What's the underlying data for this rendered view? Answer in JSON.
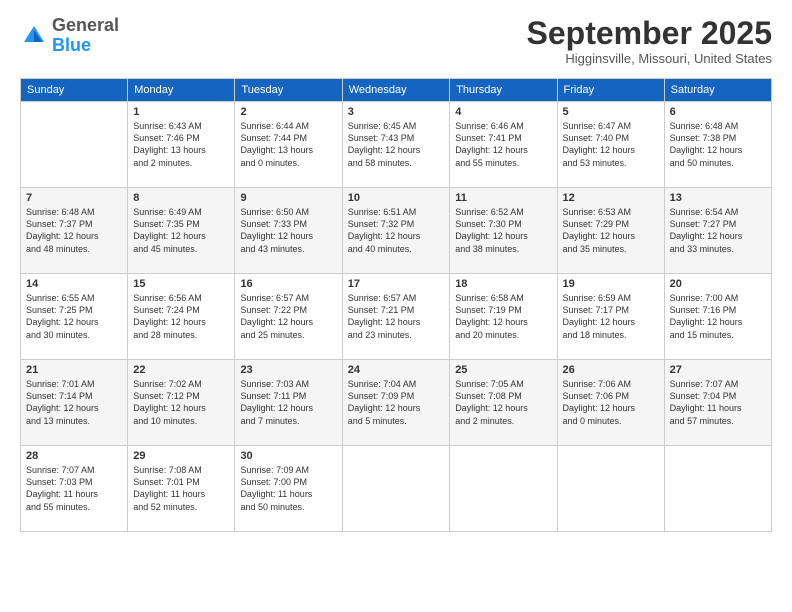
{
  "header": {
    "logo_general": "General",
    "logo_blue": "Blue",
    "month_title": "September 2025",
    "location": "Higginsville, Missouri, United States"
  },
  "days_of_week": [
    "Sunday",
    "Monday",
    "Tuesday",
    "Wednesday",
    "Thursday",
    "Friday",
    "Saturday"
  ],
  "weeks": [
    [
      {
        "day": "",
        "info": ""
      },
      {
        "day": "1",
        "info": "Sunrise: 6:43 AM\nSunset: 7:46 PM\nDaylight: 13 hours\nand 2 minutes."
      },
      {
        "day": "2",
        "info": "Sunrise: 6:44 AM\nSunset: 7:44 PM\nDaylight: 13 hours\nand 0 minutes."
      },
      {
        "day": "3",
        "info": "Sunrise: 6:45 AM\nSunset: 7:43 PM\nDaylight: 12 hours\nand 58 minutes."
      },
      {
        "day": "4",
        "info": "Sunrise: 6:46 AM\nSunset: 7:41 PM\nDaylight: 12 hours\nand 55 minutes."
      },
      {
        "day": "5",
        "info": "Sunrise: 6:47 AM\nSunset: 7:40 PM\nDaylight: 12 hours\nand 53 minutes."
      },
      {
        "day": "6",
        "info": "Sunrise: 6:48 AM\nSunset: 7:38 PM\nDaylight: 12 hours\nand 50 minutes."
      }
    ],
    [
      {
        "day": "7",
        "info": "Sunrise: 6:48 AM\nSunset: 7:37 PM\nDaylight: 12 hours\nand 48 minutes."
      },
      {
        "day": "8",
        "info": "Sunrise: 6:49 AM\nSunset: 7:35 PM\nDaylight: 12 hours\nand 45 minutes."
      },
      {
        "day": "9",
        "info": "Sunrise: 6:50 AM\nSunset: 7:33 PM\nDaylight: 12 hours\nand 43 minutes."
      },
      {
        "day": "10",
        "info": "Sunrise: 6:51 AM\nSunset: 7:32 PM\nDaylight: 12 hours\nand 40 minutes."
      },
      {
        "day": "11",
        "info": "Sunrise: 6:52 AM\nSunset: 7:30 PM\nDaylight: 12 hours\nand 38 minutes."
      },
      {
        "day": "12",
        "info": "Sunrise: 6:53 AM\nSunset: 7:29 PM\nDaylight: 12 hours\nand 35 minutes."
      },
      {
        "day": "13",
        "info": "Sunrise: 6:54 AM\nSunset: 7:27 PM\nDaylight: 12 hours\nand 33 minutes."
      }
    ],
    [
      {
        "day": "14",
        "info": "Sunrise: 6:55 AM\nSunset: 7:25 PM\nDaylight: 12 hours\nand 30 minutes."
      },
      {
        "day": "15",
        "info": "Sunrise: 6:56 AM\nSunset: 7:24 PM\nDaylight: 12 hours\nand 28 minutes."
      },
      {
        "day": "16",
        "info": "Sunrise: 6:57 AM\nSunset: 7:22 PM\nDaylight: 12 hours\nand 25 minutes."
      },
      {
        "day": "17",
        "info": "Sunrise: 6:57 AM\nSunset: 7:21 PM\nDaylight: 12 hours\nand 23 minutes."
      },
      {
        "day": "18",
        "info": "Sunrise: 6:58 AM\nSunset: 7:19 PM\nDaylight: 12 hours\nand 20 minutes."
      },
      {
        "day": "19",
        "info": "Sunrise: 6:59 AM\nSunset: 7:17 PM\nDaylight: 12 hours\nand 18 minutes."
      },
      {
        "day": "20",
        "info": "Sunrise: 7:00 AM\nSunset: 7:16 PM\nDaylight: 12 hours\nand 15 minutes."
      }
    ],
    [
      {
        "day": "21",
        "info": "Sunrise: 7:01 AM\nSunset: 7:14 PM\nDaylight: 12 hours\nand 13 minutes."
      },
      {
        "day": "22",
        "info": "Sunrise: 7:02 AM\nSunset: 7:12 PM\nDaylight: 12 hours\nand 10 minutes."
      },
      {
        "day": "23",
        "info": "Sunrise: 7:03 AM\nSunset: 7:11 PM\nDaylight: 12 hours\nand 7 minutes."
      },
      {
        "day": "24",
        "info": "Sunrise: 7:04 AM\nSunset: 7:09 PM\nDaylight: 12 hours\nand 5 minutes."
      },
      {
        "day": "25",
        "info": "Sunrise: 7:05 AM\nSunset: 7:08 PM\nDaylight: 12 hours\nand 2 minutes."
      },
      {
        "day": "26",
        "info": "Sunrise: 7:06 AM\nSunset: 7:06 PM\nDaylight: 12 hours\nand 0 minutes."
      },
      {
        "day": "27",
        "info": "Sunrise: 7:07 AM\nSunset: 7:04 PM\nDaylight: 11 hours\nand 57 minutes."
      }
    ],
    [
      {
        "day": "28",
        "info": "Sunrise: 7:07 AM\nSunset: 7:03 PM\nDaylight: 11 hours\nand 55 minutes."
      },
      {
        "day": "29",
        "info": "Sunrise: 7:08 AM\nSunset: 7:01 PM\nDaylight: 11 hours\nand 52 minutes."
      },
      {
        "day": "30",
        "info": "Sunrise: 7:09 AM\nSunset: 7:00 PM\nDaylight: 11 hours\nand 50 minutes."
      },
      {
        "day": "",
        "info": ""
      },
      {
        "day": "",
        "info": ""
      },
      {
        "day": "",
        "info": ""
      },
      {
        "day": "",
        "info": ""
      }
    ]
  ]
}
